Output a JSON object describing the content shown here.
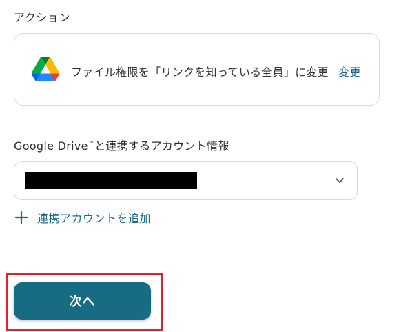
{
  "section": {
    "label": "アクション"
  },
  "action": {
    "icon": "google-drive-icon",
    "title": "ファイル権限を「リンクを知っている全員」に変更",
    "change_label": "変更"
  },
  "account": {
    "label_prefix": "Google Drive",
    "label_tm": "™",
    "label_suffix": "と連携するアカウント情報",
    "selected_value_redacted": true,
    "dropdown_icon": "chevron-down-icon",
    "add_icon": "plus-icon",
    "add_label": "連携アカウントを追加"
  },
  "footer": {
    "next_label": "次へ"
  },
  "colors": {
    "accent": "#176b83",
    "link": "#1a6a84",
    "highlight": "#e5202a",
    "border": "#d6d9dc"
  }
}
